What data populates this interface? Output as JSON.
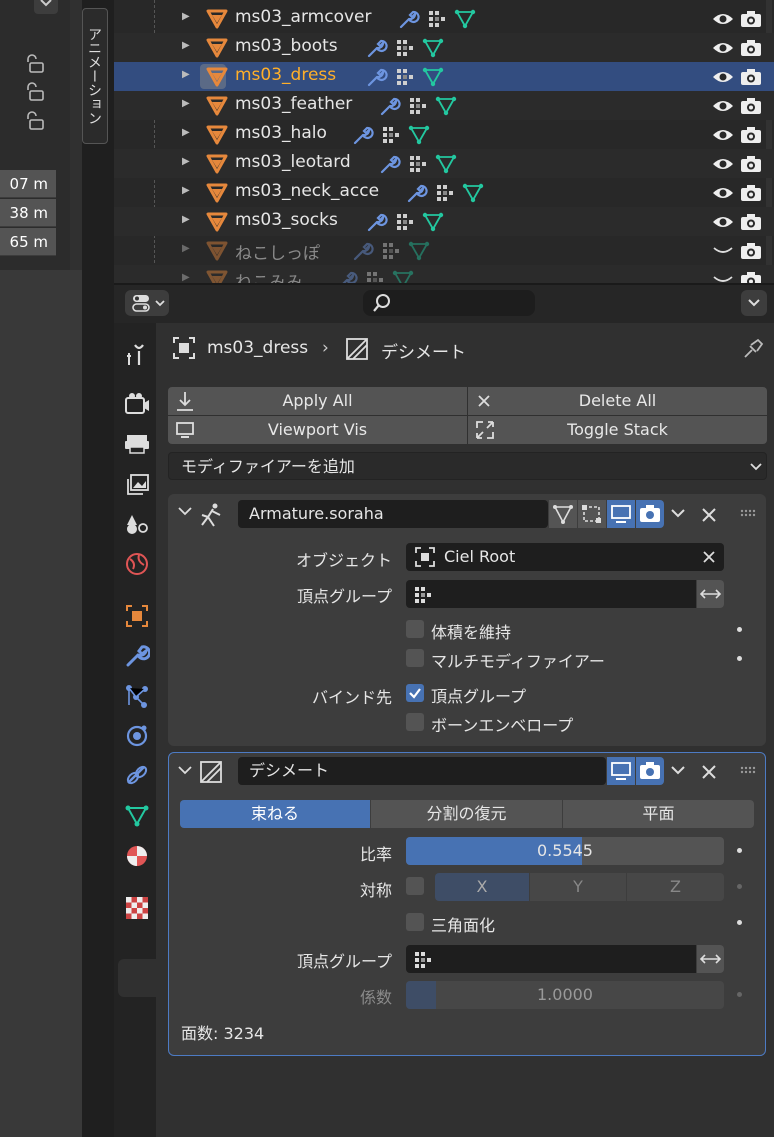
{
  "viewport": {
    "dims": [
      "07 m",
      "38 m",
      "65 m"
    ],
    "side_tab": "アニメーション"
  },
  "outliner": {
    "rows": [
      {
        "name": "ms03_armcover",
        "selected": false,
        "dim": false
      },
      {
        "name": "ms03_boots",
        "selected": false,
        "dim": false
      },
      {
        "name": "ms03_dress",
        "selected": true,
        "dim": false
      },
      {
        "name": "ms03_feather",
        "selected": false,
        "dim": false
      },
      {
        "name": "ms03_halo",
        "selected": false,
        "dim": false
      },
      {
        "name": "ms03_leotard",
        "selected": false,
        "dim": false
      },
      {
        "name": "ms03_neck_acce",
        "selected": false,
        "dim": false
      },
      {
        "name": "ms03_socks",
        "selected": false,
        "dim": false
      },
      {
        "name": "ねこしっぽ",
        "selected": false,
        "dim": true
      },
      {
        "name": "ねこみみ",
        "selected": false,
        "dim": true
      }
    ]
  },
  "properties": {
    "search_placeholder": "",
    "breadcrumb": {
      "object": "ms03_dress",
      "modifier": "デシメート"
    },
    "toolbar": {
      "apply_all": "Apply All",
      "delete_all": "Delete All",
      "viewport_vis": "Viewport Vis",
      "toggle_stack": "Toggle Stack"
    },
    "add_modifier": "モディファイアーを追加",
    "armature": {
      "name": "Armature.soraha",
      "object_label": "オブジェクト",
      "object_value": "Ciel Root",
      "vgroup_label": "頂点グループ",
      "preserve_volume": "体積を維持",
      "multi_modifier": "マルチモディファイアー",
      "bind_to_label": "バインド先",
      "bind_vgroups": "頂点グループ",
      "bind_bone_env": "ボーンエンベロープ"
    },
    "decimate": {
      "name": "デシメート",
      "modes": [
        "束ねる",
        "分割の復元",
        "平面"
      ],
      "ratio_label": "比率",
      "ratio_value": "0.5545",
      "ratio": 0.5545,
      "symmetry_label": "対称",
      "axes": [
        "X",
        "Y",
        "Z"
      ],
      "triangulate": "三角面化",
      "vgroup_label": "頂点グループ",
      "factor_label": "係数",
      "factor_value": "1.0000",
      "factor": 1.0,
      "face_count": "面数: 3234"
    }
  },
  "colors": {
    "accent": "#4772b3",
    "selected_name": "#ffaf29",
    "mesh_icon": "#e6883c",
    "vertex_icon": "#23c8a0",
    "wrench_icon": "#6d95e0"
  }
}
